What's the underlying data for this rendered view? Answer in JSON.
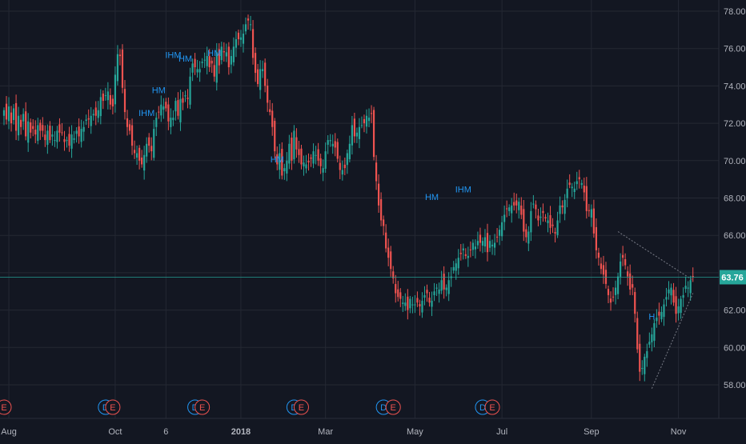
{
  "colors": {
    "background": "#131722",
    "grid": "#242833",
    "axis_text": "#b2b5be",
    "up": "#26a69a",
    "down": "#ef5350",
    "price_line": "#26a69a",
    "price_tag_text": "#ffffff",
    "pattern_label": "#2196f3",
    "event_dividend": "#2196f3",
    "event_earnings": "#ef5350",
    "trendline": "#787b86"
  },
  "chart_data": {
    "type": "candlestick",
    "title": "",
    "xlabel": "",
    "ylabel": "",
    "ylim": [
      56.2,
      78.6
    ],
    "y_ticks": [
      "58.00",
      "60.00",
      "62.00",
      "64.00",
      "66.00",
      "68.00",
      "70.00",
      "72.00",
      "74.00",
      "76.00",
      "78.00"
    ],
    "x_ticks": [
      {
        "label": "Aug",
        "bar": 2,
        "bold": false
      },
      {
        "label": "Oct",
        "bar": 46,
        "bold": false
      },
      {
        "label": "6",
        "bar": 67,
        "bold": false
      },
      {
        "label": "2018",
        "bar": 98,
        "bold": true
      },
      {
        "label": "Mar",
        "bar": 133,
        "bold": false
      },
      {
        "label": "May",
        "bar": 170,
        "bold": false
      },
      {
        "label": "Jul",
        "bar": 206,
        "bold": false
      },
      {
        "label": "Sep",
        "bar": 243,
        "bold": false
      },
      {
        "label": "Nov",
        "bar": 279,
        "bold": false
      }
    ],
    "last_price": "63.76",
    "grid": true,
    "closes": [
      72.7,
      72.2,
      72.9,
      72.0,
      72.8,
      71.6,
      72.4,
      71.8,
      72.5,
      71.3,
      72.1,
      71.5,
      71.7,
      71.4,
      71.9,
      71.6,
      71.6,
      71.1,
      71.6,
      71.1,
      71.4,
      71.1,
      71.6,
      71.5,
      71.5,
      71.0,
      71.1,
      70.8,
      71.4,
      71.2,
      71.6,
      71.3,
      71.7,
      71.8,
      72.2,
      72.2,
      72.4,
      72.5,
      72.4,
      72.7,
      73.4,
      73.2,
      73.5,
      73.7,
      73.0,
      72.9,
      74.6,
      75.7,
      75.6,
      73.9,
      72.6,
      71.8,
      71.6,
      70.8,
      70.4,
      70.4,
      70.0,
      69.8,
      70.3,
      70.9,
      70.8,
      70.5,
      71.7,
      72.3,
      72.6,
      73.0,
      72.9,
      72.8,
      72.1,
      72.3,
      72.3,
      73.2,
      72.4,
      73.3,
      73.1,
      73.5,
      73.3,
      74.5,
      75.2,
      75.0,
      74.9,
      74.9,
      75.3,
      75.4,
      75.6,
      75.0,
      75.2,
      74.5,
      75.8,
      75.1,
      76.1,
      75.8,
      75.8,
      75.0,
      75.6,
      76.1,
      76.5,
      76.5,
      76.6,
      76.8,
      77.3,
      77.5,
      77.3,
      75.5,
      74.7,
      74.1,
      74.9,
      74.9,
      74.0,
      73.1,
      72.6,
      71.8,
      70.5,
      69.8,
      70.4,
      69.2,
      69.6,
      70.0,
      70.9,
      70.0,
      71.6,
      70.6,
      70.3,
      69.8,
      69.9,
      69.8,
      69.9,
      70.1,
      70.5,
      70.3,
      70.0,
      69.7,
      69.6,
      70.5,
      71.1,
      71.1,
      70.9,
      70.7,
      70.1,
      69.5,
      69.5,
      69.6,
      70.4,
      70.9,
      71.9,
      71.3,
      71.5,
      71.8,
      71.9,
      72.0,
      72.4,
      72.3,
      72.5,
      70.2,
      68.9,
      67.6,
      66.8,
      66.5,
      65.3,
      64.8,
      64.2,
      63.7,
      62.9,
      62.7,
      62.6,
      62.4,
      62.4,
      62.0,
      62.6,
      62.3,
      62.3,
      62.4,
      62.2,
      62.5,
      62.8,
      62.9,
      62.4,
      62.5,
      63.0,
      63.2,
      63.1,
      63.6,
      63.1,
      63.2,
      63.6,
      63.8,
      64.3,
      64.5,
      64.8,
      65.0,
      65.3,
      64.9,
      64.9,
      65.2,
      65.6,
      65.4,
      65.7,
      65.6,
      65.7,
      65.9,
      65.1,
      65.7,
      65.5,
      65.6,
      65.9,
      66.3,
      66.7,
      67.1,
      67.4,
      67.5,
      67.6,
      67.6,
      67.6,
      67.8,
      67.1,
      66.2,
      65.9,
      66.2,
      67.3,
      67.7,
      67.4,
      66.8,
      67.0,
      67.2,
      66.9,
      66.8,
      66.4,
      66.5,
      66.1,
      66.8,
      67.6,
      67.5,
      67.9,
      68.5,
      68.7,
      68.6,
      68.5,
      68.9,
      69.0,
      68.8,
      68.3,
      67.3,
      67.3,
      67.4,
      66.1,
      65.2,
      64.8,
      64.2,
      63.9,
      63.4,
      62.8,
      62.4,
      62.7,
      63.2,
      63.8,
      64.6,
      64.8,
      64.4,
      63.8,
      63.1,
      63.2,
      61.8,
      59.9,
      58.7,
      58.9,
      59.5,
      59.8,
      60.3,
      60.7,
      61.3,
      61.6,
      61.7,
      61.9,
      62.3,
      62.7,
      63.1,
      63.2,
      62.4,
      61.8,
      62.2,
      62.6,
      62.8,
      63.3,
      63.2,
      63.6,
      63.8
    ]
  },
  "pattern_labels": [
    {
      "text": "IHM",
      "bar": 59,
      "price": 72.4
    },
    {
      "text": "HM",
      "bar": 64,
      "price": 73.6
    },
    {
      "text": "IHM",
      "bar": 70,
      "price": 75.5
    },
    {
      "text": "HM",
      "bar": 75,
      "price": 75.3
    },
    {
      "text": "HM",
      "bar": 87,
      "price": 75.6
    },
    {
      "text": "HM",
      "bar": 113,
      "price": 69.9
    },
    {
      "text": "HM",
      "bar": 177,
      "price": 67.9
    },
    {
      "text": "IHM",
      "bar": 190,
      "price": 68.3
    },
    {
      "text": "H",
      "bar": 268,
      "price": 61.5
    }
  ],
  "events": [
    {
      "type": "E",
      "bar": 0
    },
    {
      "type": "D",
      "bar": 42
    },
    {
      "type": "E",
      "bar": 45
    },
    {
      "type": "D",
      "bar": 79
    },
    {
      "type": "E",
      "bar": 82
    },
    {
      "type": "D",
      "bar": 120
    },
    {
      "type": "E",
      "bar": 123
    },
    {
      "type": "D",
      "bar": 157
    },
    {
      "type": "E",
      "bar": 161
    },
    {
      "type": "D",
      "bar": 198
    },
    {
      "type": "E",
      "bar": 202
    }
  ]
}
